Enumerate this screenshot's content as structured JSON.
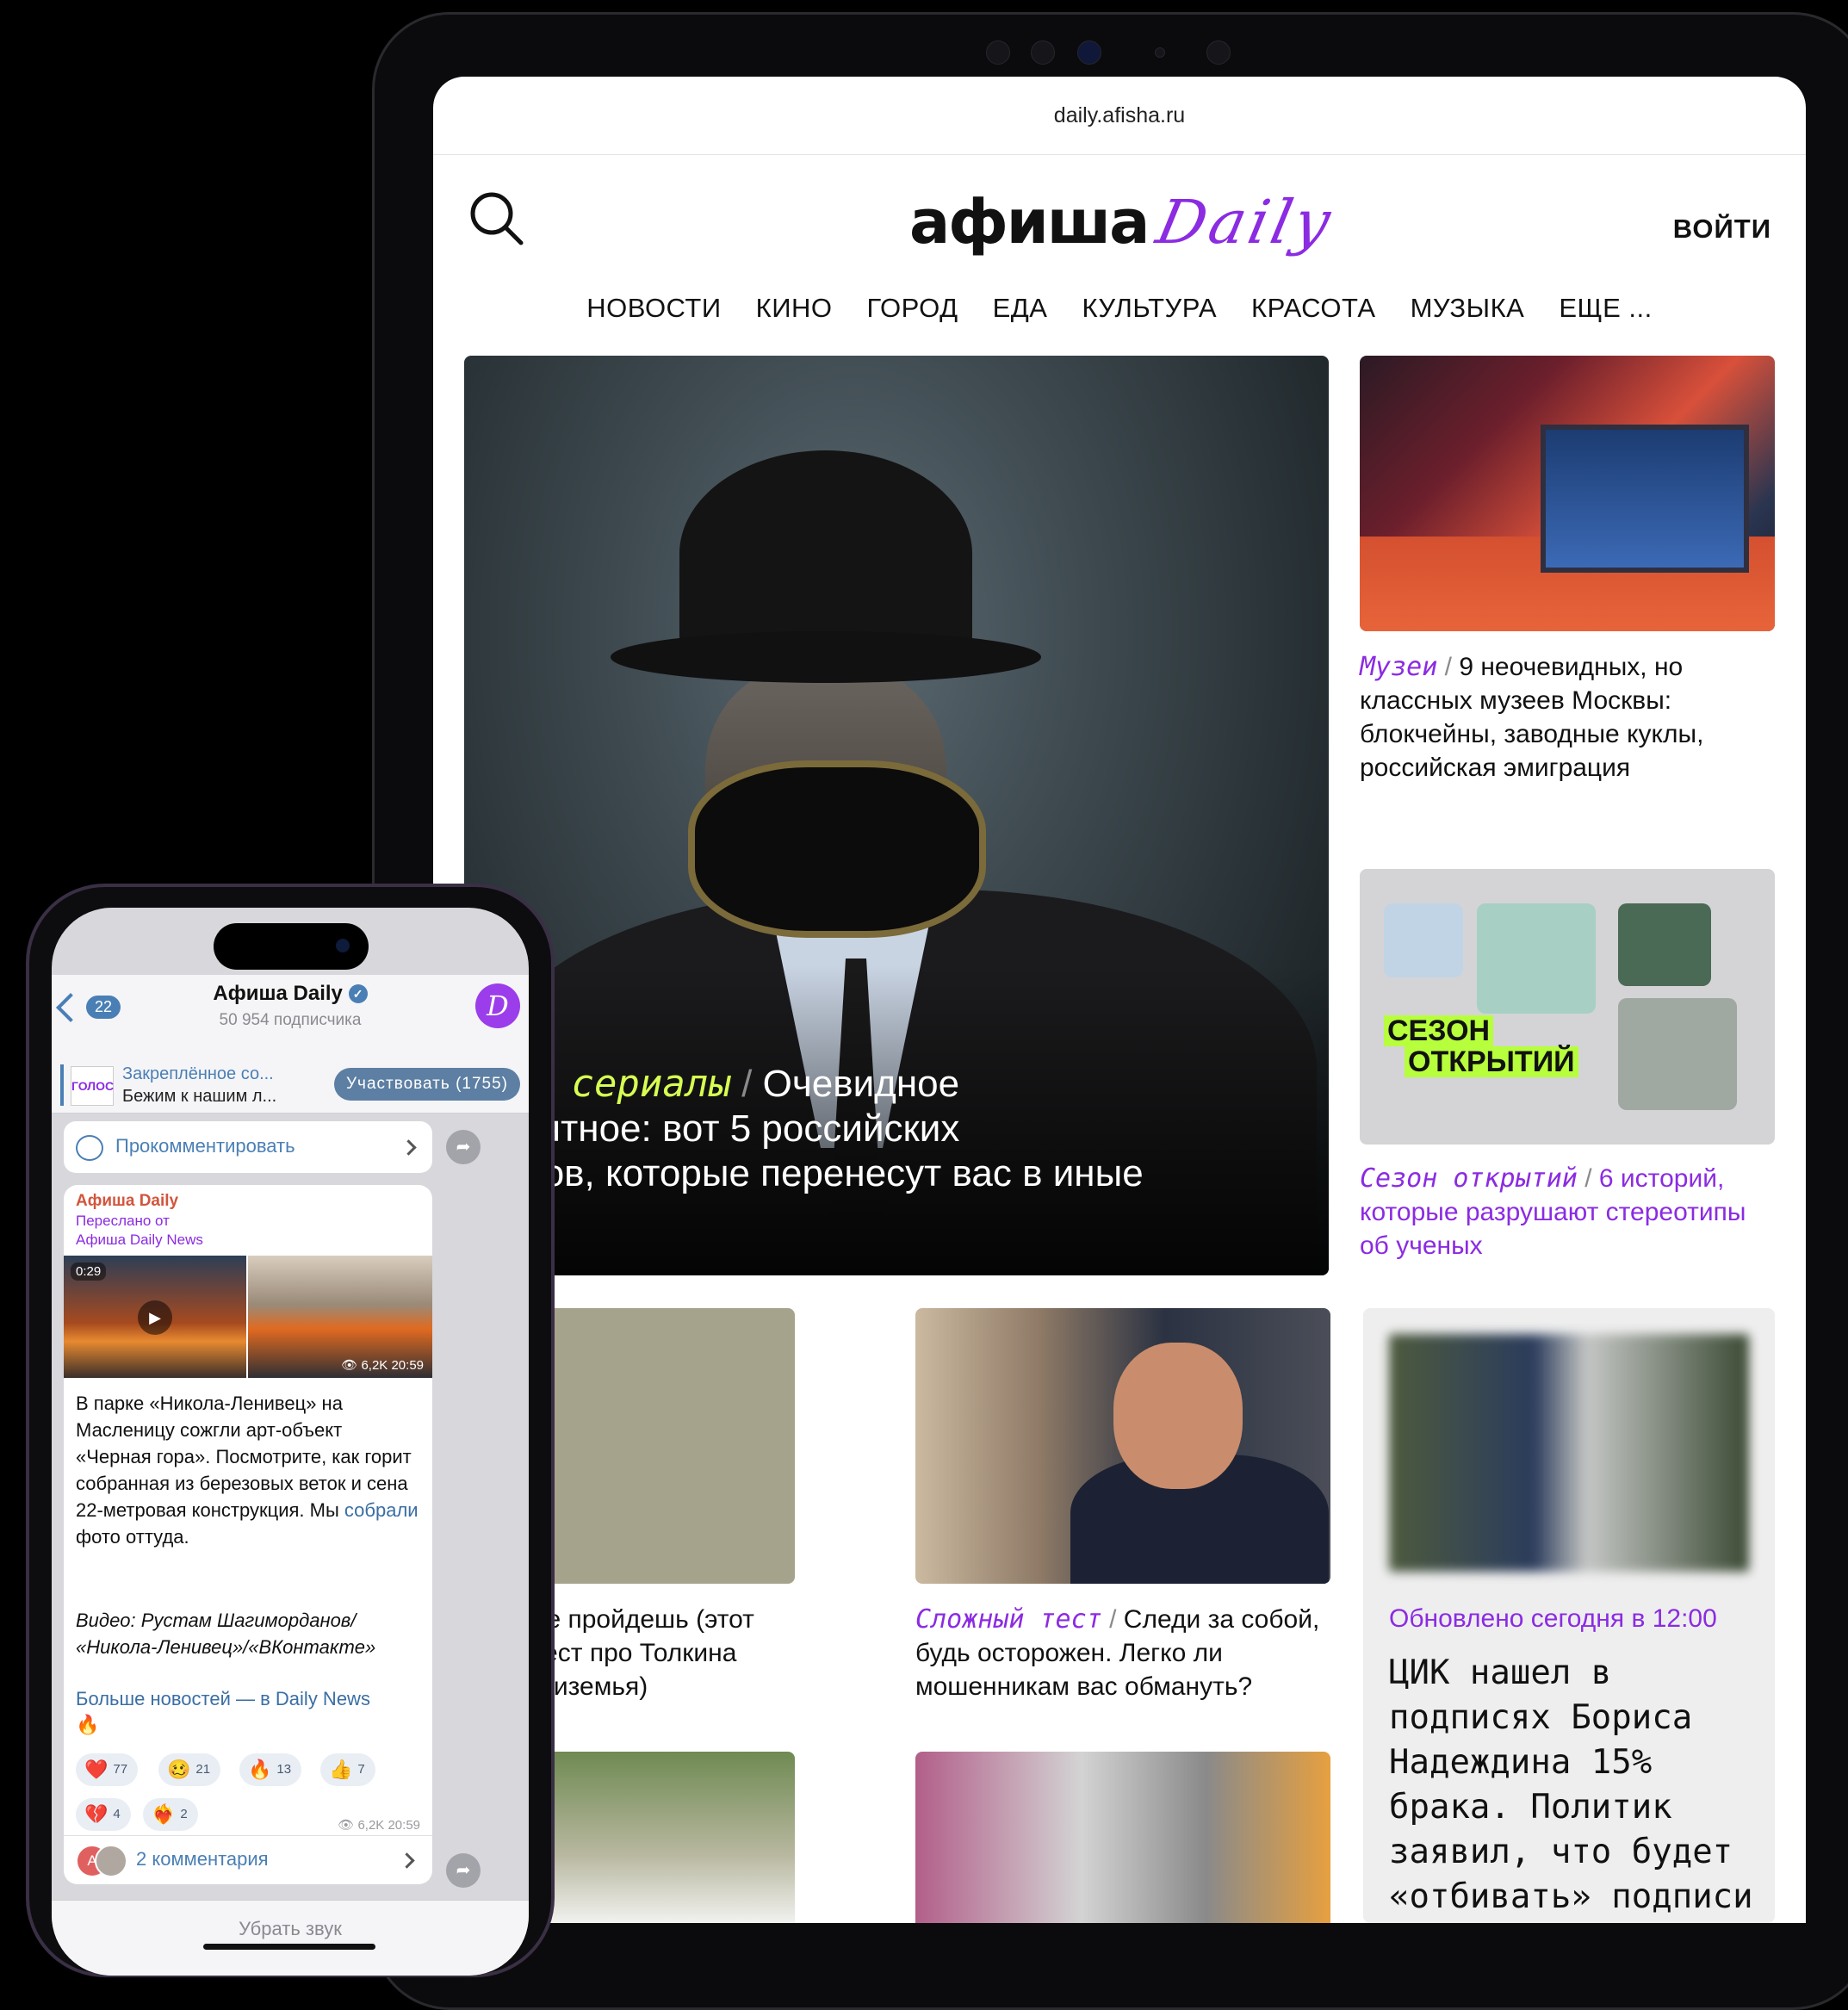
{
  "browser": {
    "url": "daily.afisha.ru"
  },
  "site": {
    "logo_main": "афиша",
    "logo_script": "Daily",
    "login": "ВОЙТИ",
    "nav": [
      "НОВОСТИ",
      "КИНО",
      "ГОРОД",
      "ЕДА",
      "КУЛЬТУРА",
      "КРАСОТА",
      "МУЗЫКА",
      "ЕЩЕ ..."
    ],
    "hero": {
      "rubric": "ские сериалы",
      "separator": "/",
      "title": "Очевидное вероятное: вот 5 российских сериалов, которые перенесут вас в иные миры",
      "title_visible": "Очевидное\nвероятное: вот 5 российских\nриалов, которые перенесут вас в иные\nры"
    },
    "side_card_1": {
      "rubric": "Музеи",
      "separator": "/",
      "title": "9 неочевидных, но классных музеев Москвы: блокчейны, заводные куклы, российская эмиграция"
    },
    "side_card_2": {
      "image_label_line1": "СЕЗОН",
      "image_label_line2": "ОТКРЫТИЙ",
      "rubric": "Сезон открытий",
      "separator": "/",
      "title": "6 историй, которые разрушают стереотипы об ученых"
    },
    "row2_card_a": {
      "title": "Ты не пройдешь (этот\nый тест про Толкина\nСредиземья)"
    },
    "row2_card_b": {
      "rubric": "Сложный тест",
      "separator": "/",
      "title": "Следи за собой, будь осторожен. Легко ли мошенникам вас обмануть?"
    },
    "news_card": {
      "updated": "Обновлено сегодня в 12:00",
      "title": "ЦИК нашел в подписях Бориса Надеждина 15% брака. Политик заявил, что будет «отбивать» подписи"
    }
  },
  "telegram": {
    "back_count": "22",
    "channel_name": "Афиша Daily",
    "subscribers": "50 954 подписчика",
    "avatar_letter": "D",
    "pinned": {
      "label": "Закреплённое со...",
      "preview": "Бежим к нашим л...",
      "thumb": "ГОЛОС",
      "join_button": "Участвовать (1755)"
    },
    "comment_placeholder": "Прокомментировать",
    "post": {
      "author": "Афиша Daily",
      "forwarded_label": "Переслано от",
      "forwarded_from": "Афиша Daily News",
      "video_duration": "0:29",
      "media_meta": "6,2K 20:59",
      "body_part1": "В парке «Никола-Ленивец» на Масленицу сожгли арт-объект «Черная гора». Посмотрите, как горит собранная из березовых веток и сена 22-метровая конструкция. Мы ",
      "body_link": "собрали",
      "body_part2": " фото оттуда.",
      "credit": "Видео: Рустам Шагимордანов/ «Никола-Ленивец»/«ВКонтакте»",
      "more_link": "Больше новостей — в Daily News",
      "fire": "🔥",
      "reactions": [
        {
          "emoji": "❤️",
          "count": "77"
        },
        {
          "emoji": "🥴",
          "count": "21"
        },
        {
          "emoji": "🔥",
          "count": "13"
        },
        {
          "emoji": "👍",
          "count": "7"
        },
        {
          "emoji": "💔",
          "count": "4"
        },
        {
          "emoji": "❤️‍🔥",
          "count": "2"
        }
      ],
      "stamp": "6,2K 20:59",
      "comments_avatar": "A",
      "comments": "2 комментария"
    },
    "mute": "Убрать звук"
  },
  "colors": {
    "accent": "#8b2be2",
    "hero_rubric": "#d7ff52",
    "tg_link": "#3a6ea5",
    "tg_author": "#d2553d"
  },
  "icons": [
    "search-icon",
    "back-chevron-icon",
    "verified-icon",
    "comment-icon",
    "chevron-right-icon",
    "share-icon",
    "play-icon",
    "eye-icon"
  ]
}
